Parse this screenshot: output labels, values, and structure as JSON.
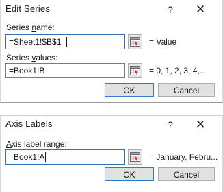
{
  "edit_series": {
    "title": "Edit Series",
    "help_label": "?",
    "close_label": "✕",
    "name_label_pre": "Series ",
    "name_label_ul": "n",
    "name_label_post": "ame:",
    "name_value": "=Sheet1!$B$1",
    "name_preview": "= Value",
    "values_label_pre": "Series ",
    "values_label_ul": "v",
    "values_label_post": "alues:",
    "values_value": "=Book1!B",
    "values_preview": "= 0, 1, 2, 3, 4,...",
    "ok_label": "OK",
    "cancel_label": "Cancel"
  },
  "axis_labels": {
    "title": "Axis Labels",
    "help_label": "?",
    "close_label": "✕",
    "range_label_ul": "A",
    "range_label_post": "xis label range:",
    "range_value": "=Book1!A",
    "range_preview": "= January, Febru...",
    "ok_label": "OK",
    "cancel_label": "Cancel"
  },
  "icons": {
    "collapse": "range-collapse-icon",
    "help": "help-icon",
    "close": "close-icon"
  },
  "colors": {
    "focus_border": "#2f6fb5",
    "default_button_border": "#2f78d1",
    "button_face": "#e1e1e1",
    "icon_red": "#c8281e"
  }
}
